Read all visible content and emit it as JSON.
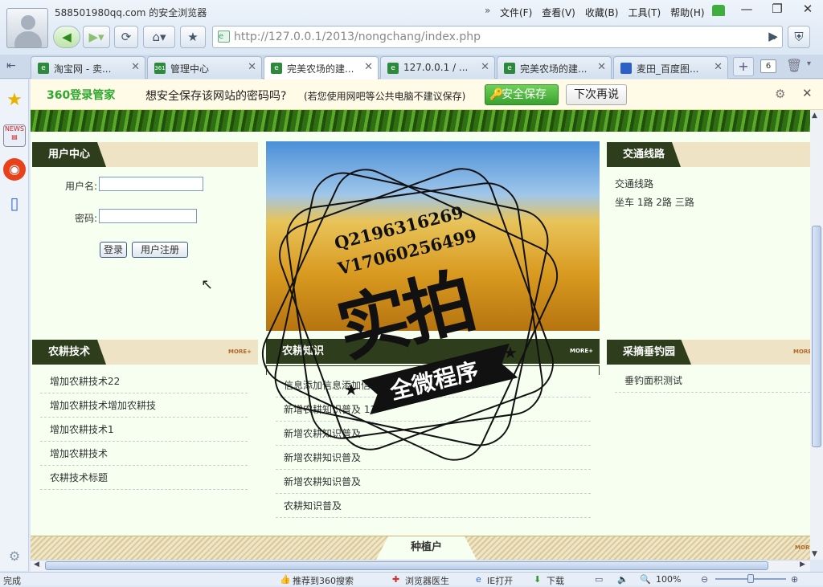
{
  "window": {
    "account_title": "588501980qq.com 的安全浏览器"
  },
  "menu": [
    "文件(F)",
    "查看(V)",
    "收藏(B)",
    "工具(T)",
    "帮助(H)"
  ],
  "address": {
    "url": "http://127.0.0.1/2013/nongchang/index.php"
  },
  "tabs": [
    {
      "label": "淘宝网 - 卖...",
      "color": "#2d8a3c",
      "icon": "e"
    },
    {
      "label": "管理中心",
      "color": "#2d8a3c",
      "icon": "360"
    },
    {
      "label": "完美农场的建...",
      "color": "#2d8a3c",
      "icon": "e"
    },
    {
      "label": "127.0.0.1 / ...",
      "color": "#2d8a3c",
      "icon": "e"
    },
    {
      "label": "完美农场的建...",
      "color": "#2d8a3c",
      "icon": "e"
    },
    {
      "label": "麦田_百度图...",
      "color": "#2f5fc4",
      "icon": "paw"
    }
  ],
  "tab_count": "6",
  "password_bar": {
    "brand": "360登录管家",
    "question": "想安全保存该网站的密码吗?",
    "note": "(若您使用网吧等公共电脑不建议保存)",
    "save": "安全保存",
    "later": "下次再说"
  },
  "user_center": {
    "title": "用户中心",
    "username_label": "用户名:",
    "password_label": "密码:",
    "username_value": "",
    "password_value": "",
    "login": "登录",
    "register": "用户注册"
  },
  "traffic": {
    "title": "交通线路",
    "line1": "交通线路",
    "line2": "坐车 1路 2路 三路"
  },
  "farming": {
    "title": "农耕技术",
    "more": "MORE+",
    "items": [
      "增加农耕技术22",
      "增加农耕技术增加农耕技",
      "增加农耕技术1",
      "增加农耕技术",
      "农耕技术标题"
    ]
  },
  "knowledge": {
    "title": "农耕知识",
    "more": "MORE+",
    "items": [
      "信息添加信息添加信息",
      "新增农耕知识普及 11",
      "新增农耕知识普及",
      "新增农耕知识普及",
      "新增农耕知识普及",
      "农耕知识普及"
    ]
  },
  "picking": {
    "title": "采摘垂钓园",
    "more": "MORE+",
    "items": [
      "垂钓面积测试"
    ]
  },
  "planters": {
    "title": "种植户",
    "more": "MORE+"
  },
  "watermark": {
    "contact1": "Q2196316269",
    "contact2": "V17060256499",
    "big": "实拍",
    "ribbon": "全微程序"
  },
  "status": {
    "left": "完成",
    "recommend": "推荐到360搜索",
    "doctor": "浏览器医生",
    "ie": "IE打开",
    "download": "下载",
    "zoom": "100%"
  }
}
